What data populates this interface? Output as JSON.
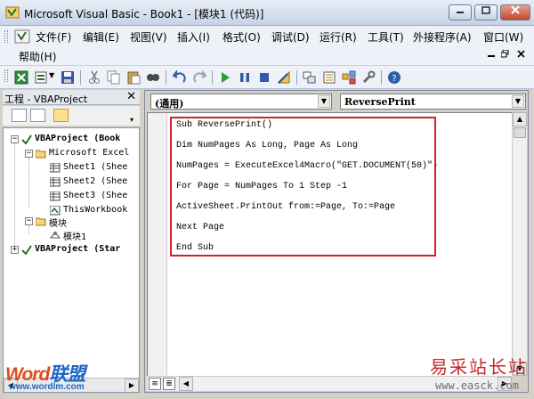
{
  "window": {
    "title": "Microsoft Visual Basic - Book1 - [模块1 (代码)]"
  },
  "menubar": {
    "row1": [
      "文件(F)",
      "编辑(E)",
      "视图(V)",
      "插入(I)",
      "格式(O)",
      "调试(D)",
      "运行(R)",
      "工具(T)",
      "外接程序(A)",
      "窗口(W)"
    ],
    "row2": [
      "帮助(H)"
    ]
  },
  "project": {
    "title": "工程 - VBAProject",
    "tree": [
      "VBAProject (Book",
      "Microsoft Excel",
      "Sheet1 (Shee",
      "Sheet2 (Shee",
      "Sheet3 (Shee",
      "ThisWorkbook",
      "模块",
      "模块1",
      "VBAProject (Star"
    ]
  },
  "code": {
    "object_combo": "(通用)",
    "procedure_combo": "ReversePrint",
    "lines": [
      "Sub ReversePrint()",
      "Dim NumPages As Long, Page As Long",
      "NumPages = ExecuteExcel4Macro(\"GET.DOCUMENT(50)\")",
      "For Page = NumPages To 1 Step -1",
      "ActiveSheet.PrintOut from:=Page, To:=Page",
      "Next Page",
      "End Sub"
    ]
  },
  "watermarks": {
    "word": "Word",
    "lianmeng": "联盟",
    "url": "www.wordlm.com",
    "cn": "易采站长站",
    "easck": "www.easck.com"
  },
  "colors": {
    "highlight_border": "#d81f27",
    "title_gradient": "#c6d3e6"
  },
  "icons": {
    "app": "vba-app-icon",
    "toolbar": [
      "excel-view-icon",
      "insert-module-icon",
      "save-icon",
      "cut-icon",
      "copy-icon",
      "paste-icon",
      "find-icon",
      "undo-icon",
      "redo-icon",
      "run-icon",
      "break-icon",
      "reset-icon",
      "design-mode-icon",
      "project-explorer-icon",
      "properties-icon",
      "object-browser-icon",
      "toolbox-icon",
      "help-icon"
    ]
  }
}
